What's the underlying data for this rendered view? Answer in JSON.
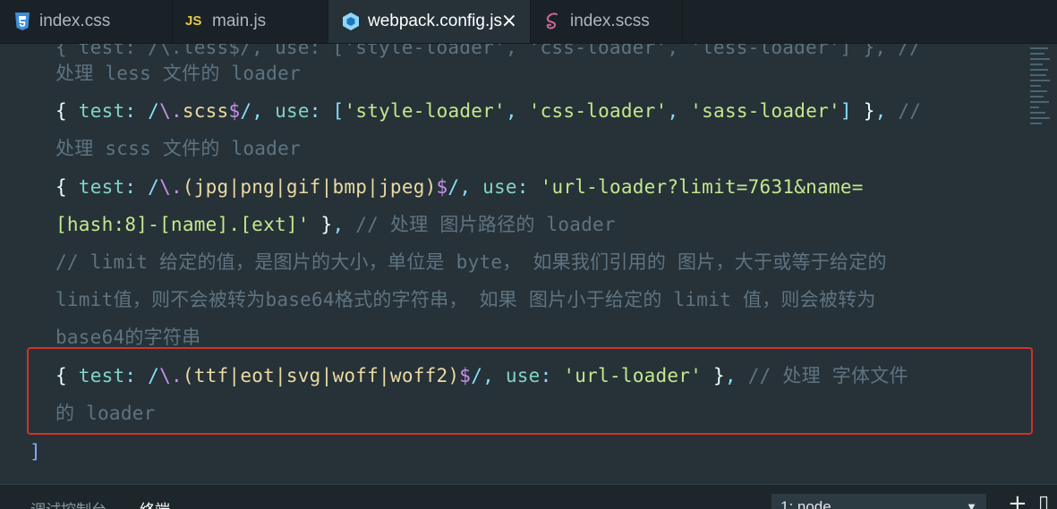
{
  "tabs": [
    {
      "label": "index.css",
      "icon": "css3-icon",
      "color": "#3d8fdb"
    },
    {
      "label": "main.js",
      "icon": "js-icon",
      "color": "#e6c84a"
    },
    {
      "label": "webpack.config.js",
      "icon": "webpack-icon",
      "color": "#8ed6fb",
      "active": true,
      "close": "×"
    },
    {
      "label": "index.scss",
      "icon": "sass-icon",
      "color": "#cd6799"
    }
  ],
  "editor": {
    "lines": [
      "处理 less 文件的 loader",
      "{ test: /\\.scss$/, use: ['style-loader', 'css-loader', 'sass-loader'] }, //",
      "处理 scss 文件的 loader",
      "{ test: /\\.(jpg|png|gif|bmp|jpeg)$/, use: 'url-loader?limit=7631&name=",
      "[hash:8]-[name].[ext]' }, // 处理 图片路径的 loader",
      "// limit 给定的值，是图片的大小，单位是 byte， 如果我们引用的 图片，大于或等于给定的",
      "limit值，则不会被转为base64格式的字符串， 如果 图片小于给定的 limit 值，则会被转为",
      "base64的字符串",
      "{ test: /\\.(ttf|eot|svg|woff|woff2)$/, use: 'url-loader' }, // 处理 字体文件",
      "的 loader",
      "]"
    ]
  },
  "panel": {
    "tabs": [
      "调试控制台",
      "终端"
    ],
    "active_tab": "终端",
    "terminal_select": "1: node",
    "add_button": "+",
    "split_button": "▯"
  },
  "colors": {
    "highlight_border": "#d2302a",
    "editor_bg": "#263238"
  }
}
